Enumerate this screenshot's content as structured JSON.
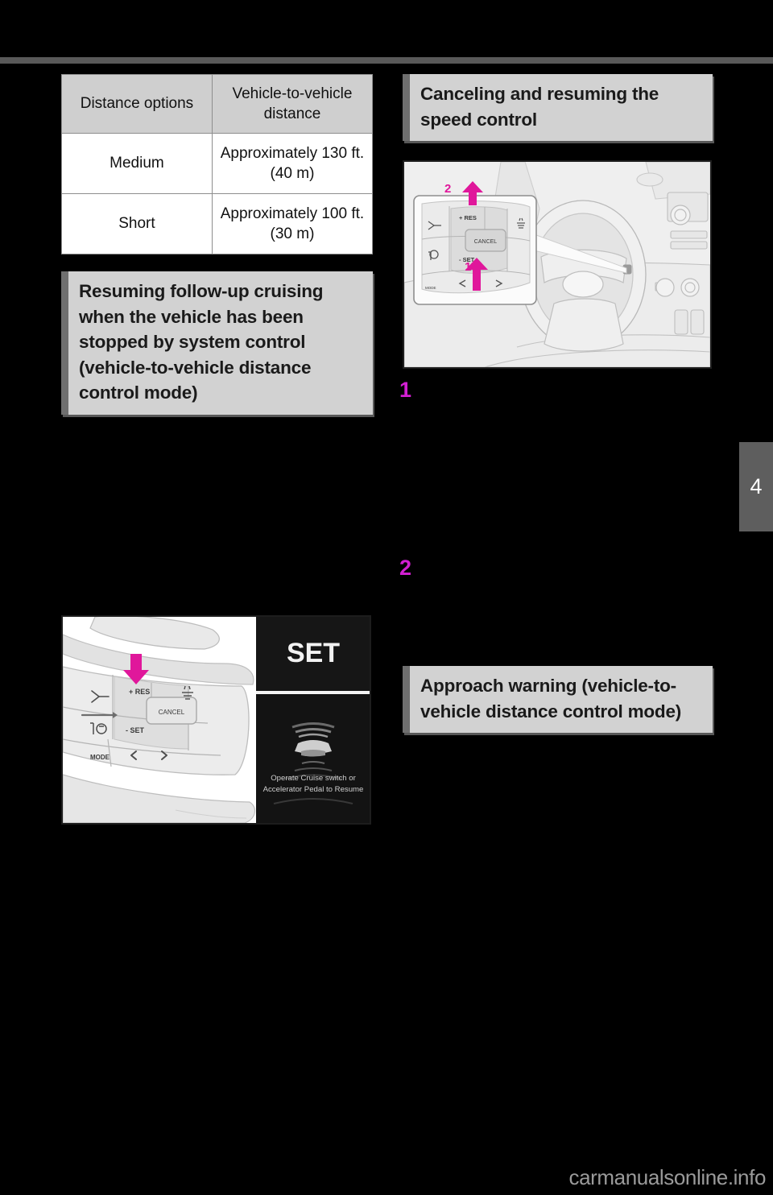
{
  "page": {
    "chapter_tab": "4",
    "watermark": "carmanualsonline.info"
  },
  "table": {
    "name": "distance-options-table",
    "headers": [
      "Distance options",
      "Vehicle-to-vehicle distance"
    ],
    "rows": [
      [
        "Medium",
        "Approximately 130 ft. (40 m)"
      ],
      [
        "Short",
        "Approximately 100 ft. (30 m)"
      ]
    ]
  },
  "headings": {
    "resuming": "Resuming follow-up cruising when the vehicle has been stopped by system control (vehicle-to-vehicle distance control mode)",
    "canceling": "Canceling and resuming the speed control",
    "approach": "Approach warning (vehicle-to-vehicle distance control mode)"
  },
  "steps": {
    "one": "1",
    "two": "2"
  },
  "figure_dashboard": {
    "name": "dashboard-cruise-switch-figure",
    "callouts": [
      "2",
      "1"
    ],
    "switch_labels": {
      "res": "+ RES",
      "set": "- SET",
      "cancel": "CANCEL"
    }
  },
  "figure_wheel": {
    "name": "steering-wheel-switch-figure",
    "switch_labels": {
      "res": "+ RES",
      "set": "- SET",
      "cancel": "CANCEL",
      "mode": "MODE",
      "left_arrow": "‹",
      "right_arrow": "›"
    },
    "display": {
      "set_indicator": "SET",
      "message_line_1": "Operate Cruise switch or",
      "message_line_2": "Accelerator Pedal to Resume"
    }
  },
  "colors": {
    "accent_magenta": "#e0179b",
    "heading_bg": "#d2d2d2",
    "heading_bar": "#6f6f6f",
    "table_header_bg": "#cfcfcf",
    "page_bg": "#000000",
    "rule": "#595959",
    "tab_bg": "#5e5e5e"
  }
}
